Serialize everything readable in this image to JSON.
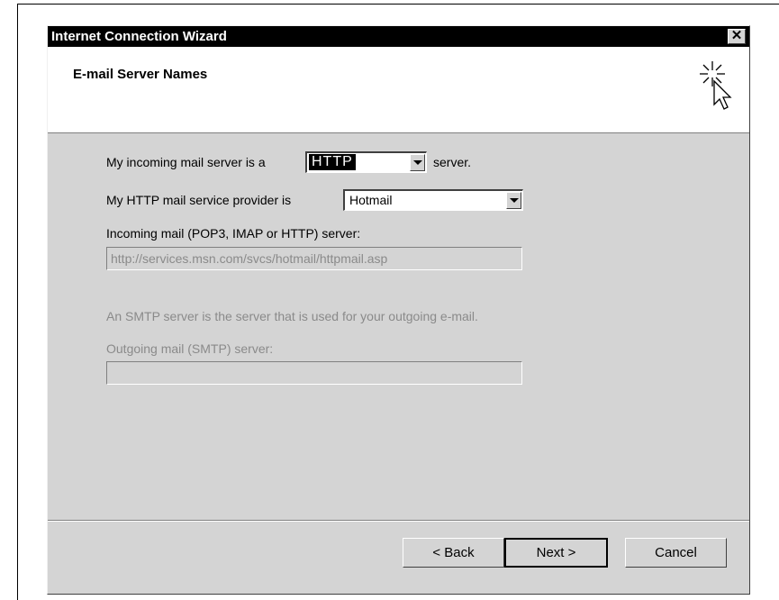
{
  "window": {
    "title": "Internet Connection Wizard",
    "close_glyph": "✕"
  },
  "header": {
    "title": "E-mail Server Names",
    "icon": "wizard-cursor-sparkle-icon"
  },
  "form": {
    "incoming_type_prefix": "My incoming mail server is a",
    "incoming_type_value": "HTTP",
    "incoming_type_suffix": "server.",
    "provider_label": "My HTTP mail service provider is",
    "provider_value": "Hotmail",
    "incoming_server_label": "Incoming mail (POP3, IMAP or HTTP) server:",
    "incoming_server_value": "http://services.msn.com/svcs/hotmail/httpmail.asp",
    "smtp_description": "An SMTP server is the server that is used for your outgoing e-mail.",
    "outgoing_server_label": "Outgoing mail (SMTP) server:",
    "outgoing_server_value": ""
  },
  "buttons": {
    "back": "< Back",
    "next": "Next >",
    "cancel": "Cancel"
  }
}
